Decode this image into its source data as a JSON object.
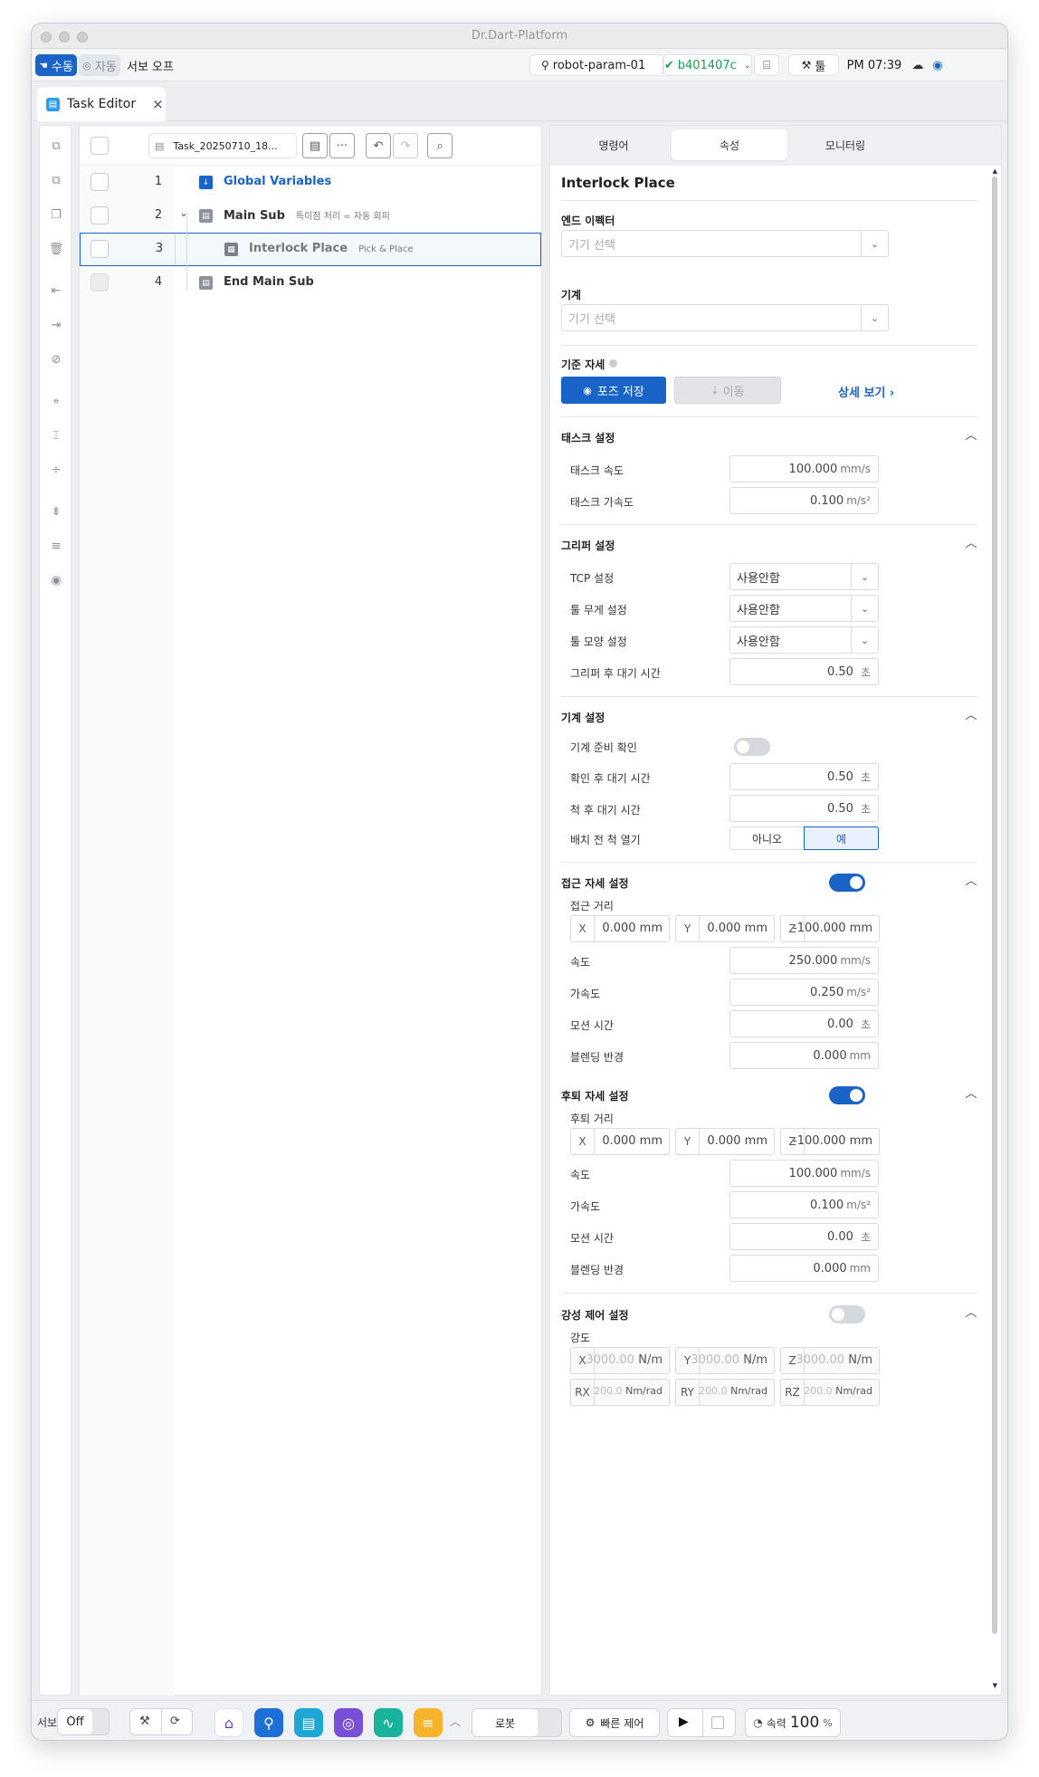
{
  "window": {
    "title": "Dr.Dart-Platform"
  },
  "topbar": {
    "mode_manual": "수동",
    "mode_auto": "자동",
    "servo_status": "서보 오프",
    "robot_name": "robot-param-01",
    "commit": "b401407c",
    "tool_label": "툴",
    "clock": "PM 07:39"
  },
  "tab": {
    "label": "Task Editor",
    "close": "×"
  },
  "editor": {
    "file_name": "Task_20250710_18...",
    "more": "···",
    "rows": [
      {
        "num": "1",
        "label": "Global Variables",
        "sub": ""
      },
      {
        "num": "2",
        "label": "Main Sub",
        "sub": "특이점 처리 = 자동 회피"
      },
      {
        "num": "3",
        "label": "Interlock Place",
        "sub": "Pick & Place"
      },
      {
        "num": "4",
        "label": "End Main Sub",
        "sub": ""
      }
    ]
  },
  "panel": {
    "tabs": [
      "명령어",
      "속성",
      "모니터링"
    ],
    "active_tab": "속성",
    "title": "Interlock Place",
    "end_effector": {
      "label": "엔드 이펙터",
      "placeholder": "기기 선택"
    },
    "machine": {
      "label": "기계",
      "placeholder": "기기 선택"
    },
    "ref_pose": {
      "label": "기준 자세",
      "save_button": "포즈 저장",
      "move_button": "이동",
      "detail_link": "상세 보기"
    },
    "task_settings": {
      "title": "태스크 설정",
      "speed": {
        "label": "태스크 속도",
        "value": "100.000",
        "unit": "mm/s"
      },
      "accel": {
        "label": "태스크 가속도",
        "value": "0.100",
        "unit": "m/s²"
      }
    },
    "gripper_settings": {
      "title": "그리퍼 설정",
      "tcp": {
        "label": "TCP 설정",
        "value": "사용안함"
      },
      "tool_weight": {
        "label": "툴 무게 설정",
        "value": "사용안함"
      },
      "tool_shape": {
        "label": "툴 모양 설정",
        "value": "사용안함"
      },
      "wait_after": {
        "label": "그리퍼 후 대기 시간",
        "value": "0.50",
        "unit": "초"
      }
    },
    "machine_settings": {
      "title": "기계 설정",
      "ready_check": {
        "label": "기계 준비 확인",
        "enabled": false
      },
      "wait_after_check": {
        "label": "확인 후 대기 시간",
        "value": "0.50",
        "unit": "초"
      },
      "wait_after_chuck": {
        "label": "척 후 대기 시간",
        "value": "0.50",
        "unit": "초"
      },
      "open_chuck": {
        "label": "배치 전 척 열기",
        "no": "아니오",
        "yes": "예",
        "selected": "예"
      }
    },
    "approach": {
      "title": "접근 자세 설정",
      "enabled": true,
      "distance_label": "접근 거리",
      "x": {
        "axis": "X",
        "value": "0.000",
        "unit": "mm"
      },
      "y": {
        "axis": "Y",
        "value": "0.000",
        "unit": "mm"
      },
      "z": {
        "axis": "Z",
        "value": "-100.000",
        "unit": "mm"
      },
      "speed": {
        "label": "속도",
        "value": "250.000",
        "unit": "mm/s"
      },
      "accel": {
        "label": "가속도",
        "value": "0.250",
        "unit": "m/s²"
      },
      "motion_time": {
        "label": "모션 시간",
        "value": "0.00",
        "unit": "초"
      },
      "blend": {
        "label": "블렌딩 반경",
        "value": "0.000",
        "unit": "mm"
      }
    },
    "retreat": {
      "title": "후퇴 자세 설정",
      "enabled": true,
      "distance_label": "후퇴 거리",
      "x": {
        "axis": "X",
        "value": "0.000",
        "unit": "mm"
      },
      "y": {
        "axis": "Y",
        "value": "0.000",
        "unit": "mm"
      },
      "z": {
        "axis": "Z",
        "value": "-100.000",
        "unit": "mm"
      },
      "speed": {
        "label": "속도",
        "value": "100.000",
        "unit": "mm/s"
      },
      "accel": {
        "label": "가속도",
        "value": "0.100",
        "unit": "m/s²"
      },
      "motion_time": {
        "label": "모션 시간",
        "value": "0.00",
        "unit": "초"
      },
      "blend": {
        "label": "블렌딩 반경",
        "value": "0.000",
        "unit": "mm"
      }
    },
    "compliance": {
      "title": "강성 제어 설정",
      "enabled": false,
      "strength_label": "강도",
      "x": {
        "axis": "X",
        "value": "3000.00",
        "unit": "N/m"
      },
      "y": {
        "axis": "Y",
        "value": "3000.00",
        "unit": "N/m"
      },
      "z": {
        "axis": "Z",
        "value": "3000.00",
        "unit": "N/m"
      },
      "rx": {
        "axis": "RX",
        "value": "200.0",
        "unit": "Nm/rad"
      },
      "ry": {
        "axis": "RY",
        "value": "200.0",
        "unit": "Nm/rad"
      },
      "rz": {
        "axis": "RZ",
        "value": "200.0",
        "unit": "Nm/rad"
      }
    }
  },
  "bottombar": {
    "servo_label": "서보",
    "servo_value": "Off",
    "robot_button": "로봇",
    "quick_control": "빠른 제어",
    "speed_label": "속력",
    "speed_value": "100",
    "speed_unit": "%"
  },
  "colors": {
    "accent": "#1a64c8",
    "success": "#1a9e4b"
  }
}
